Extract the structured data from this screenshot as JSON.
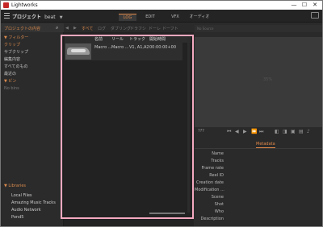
{
  "window": {
    "title": "Lightworks",
    "controls": [
      "—",
      "☐",
      "✕"
    ]
  },
  "topbar": {
    "project_label": "プロジェクト",
    "project_name": "beat",
    "tabs": [
      {
        "label": "LOG",
        "active": true
      },
      {
        "label": "EDIT",
        "active": false
      },
      {
        "label": "VFX",
        "active": false
      },
      {
        "label": "オーディオ",
        "active": false
      }
    ]
  },
  "left_panel": {
    "header": "プロジェクトの内容",
    "tree": [
      {
        "label": "▼ フィルター",
        "color": "#d98a4d"
      },
      {
        "label": "  クリップ",
        "color": "#d98a4d"
      },
      {
        "label": "  サブクリップ",
        "color": "#c8c8c8"
      },
      {
        "label": "  編集内容",
        "color": "#c8c8c8"
      },
      {
        "label": "  すべてのもの",
        "color": "#c8c8c8"
      },
      {
        "label": "  最近の",
        "color": "#c8c8c8"
      },
      {
        "label": "▼ ビン",
        "color": "#d98a4d"
      },
      {
        "label": "  No bins",
        "color": "#777777"
      }
    ],
    "libraries": {
      "header": "▼ Libraries",
      "items": [
        "Local Files",
        "Amazing Music Tracks",
        "Audio Network",
        "Pond5"
      ]
    }
  },
  "center": {
    "subbar": [
      "すべて",
      "ログ",
      "ダブリング",
      "ドラフ",
      "シ",
      "ドーレ",
      "ドーフト",
      "ファイル"
    ],
    "columns": [
      "名前",
      "リール",
      "トラック",
      "開始時間"
    ],
    "rows": [
      {
        "name": "Macro ...",
        "reel": "Macro ...",
        "tracks": "V1, A1,A2",
        "start": "00:00:00+00"
      }
    ]
  },
  "right_panel": {
    "search_placeholder": "No Source",
    "viewer_label": "35%",
    "timecode": "???",
    "metadata_tab": "Metadata",
    "metadata_fields": [
      "Name",
      "Tracks",
      "Frame rate",
      "Reel ID",
      "Creation date",
      "Modification ...",
      "Scene",
      "Shot",
      "Who",
      "Description"
    ]
  },
  "colors": {
    "accent": "#e0894a",
    "highlight_frame": "#f4a9c0"
  }
}
